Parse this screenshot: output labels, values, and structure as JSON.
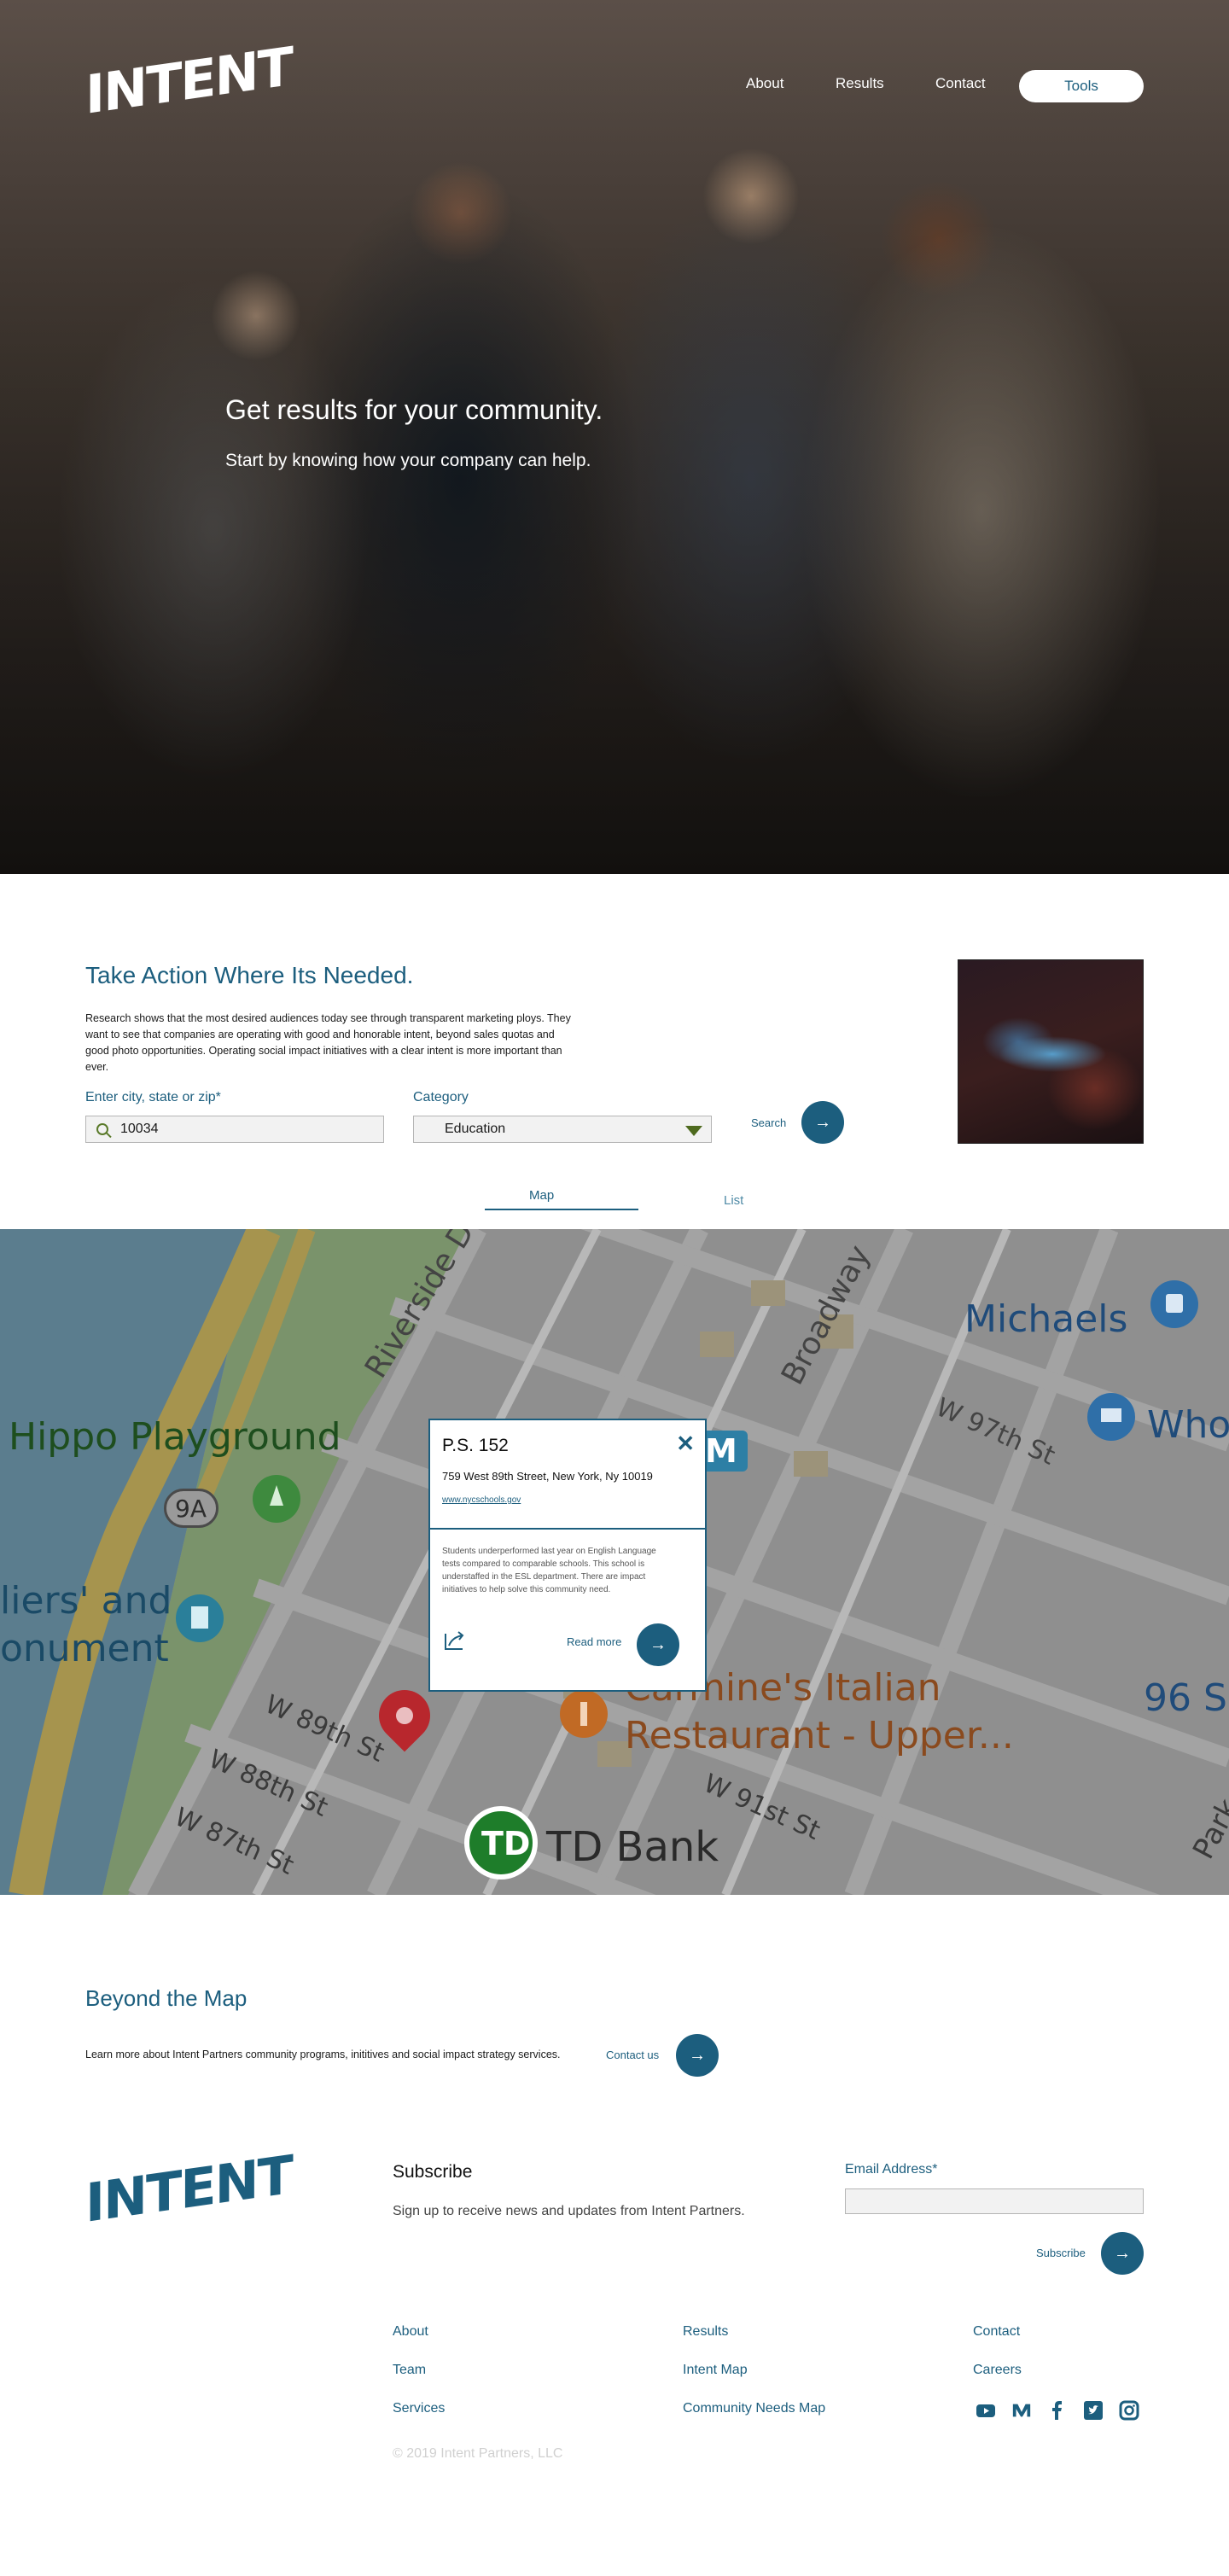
{
  "brand": {
    "logo_text": "INTENT",
    "accent_color": "#1c5e7e"
  },
  "nav": {
    "about": "About",
    "results": "Results",
    "contact": "Contact",
    "tools": "Tools"
  },
  "hero": {
    "title": "Get results for your community.",
    "subtitle": "Start by knowing how your company can help."
  },
  "action": {
    "title": "Take Action Where Its Needed.",
    "body": "Research shows that the most desired audiences today see through transparent marketing ploys. They want to see that companies are operating with good and honorable intent, beyond sales quotas and good photo opportunities. Operating social impact initiatives with a clear intent is more important than ever.",
    "location_label": "Enter city, state or zip*",
    "location_value": "10034",
    "category_label": "Category",
    "category_value": "Education",
    "search_label": "Search",
    "search_arrow": "→",
    "tabs": [
      "Map",
      "List"
    ]
  },
  "map": {
    "labels": {
      "riverside": "Riverside Dr",
      "broadway": "Broadway",
      "michaels": "Michaels",
      "who": "Who",
      "w97": "W 97th St",
      "hippo": "Hippo Playground",
      "route": "9A",
      "w9x": "W 9",
      "m_badge": "M",
      "soldiers": "liers' and",
      "monument": "onument",
      "carmines1": "Carmine's Italian",
      "carmines2": "Restaurant - Upper...",
      "w96": "96 S",
      "w89": "W 89th St",
      "w88": "W 88th St",
      "w87": "W 87th St",
      "w91": "W 91st St",
      "td": "TD Bank",
      "td_badge": "TD",
      "park": "Park"
    },
    "popup": {
      "title": "P.S. 152",
      "close": "✕",
      "address": "759 West 89th Street, New York, Ny 10019",
      "link": "www.nycschools.gov",
      "description": "Students underperformed last year on English Language tests compared to comparable schools. This school is understaffed in the ESL department. There are impact initiatives to help solve this community need.",
      "read_more": "Read more",
      "arrow": "→"
    }
  },
  "beyond": {
    "title": "Beyond the Map",
    "body": "Learn more about Intent Partners community programs, inititives and social impact strategy services.",
    "cta": "Contact us",
    "arrow": "→"
  },
  "footer": {
    "subscribe_title": "Subscribe",
    "subscribe_body": "Sign up to receive news and updates from Intent Partners.",
    "email_label": "Email Address*",
    "email_value": "",
    "subscribe_cta": "Subscribe",
    "arrow": "→",
    "links": {
      "about": "About",
      "team": "Team",
      "services": "Services",
      "results": "Results",
      "intent_map": "Intent Map",
      "community_needs_map": "Community Needs Map",
      "contact": "Contact",
      "careers": "Careers"
    },
    "social_icons": [
      "youtube-icon",
      "medium-icon",
      "facebook-icon",
      "twitter-icon",
      "instagram-icon"
    ],
    "copyright": "© 2019 Intent Partners, LLC"
  }
}
